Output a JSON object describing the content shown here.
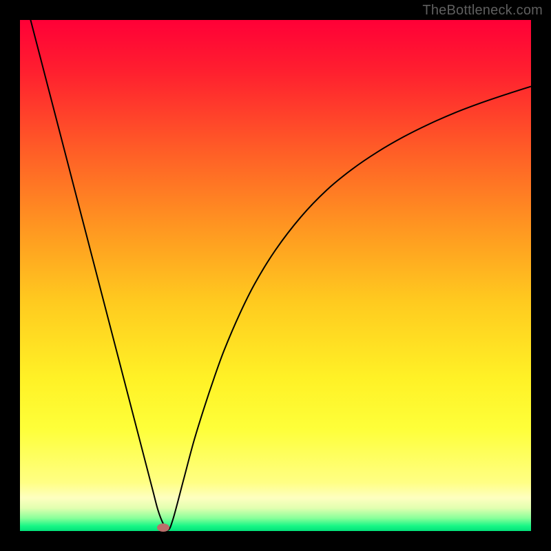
{
  "watermark": "TheBottleneck.com",
  "colors": {
    "marker": "#bb6e6b",
    "curve": "#000000",
    "frame_bg": "#000000"
  },
  "chart_data": {
    "type": "line",
    "title": "",
    "xlabel": "",
    "ylabel": "",
    "xlim": [
      0,
      100
    ],
    "ylim": [
      0,
      100
    ],
    "gradient_stops": [
      {
        "offset": 0.0,
        "color": "#ff0037"
      },
      {
        "offset": 0.1,
        "color": "#ff1f2f"
      },
      {
        "offset": 0.25,
        "color": "#ff5b27"
      },
      {
        "offset": 0.4,
        "color": "#ff9421"
      },
      {
        "offset": 0.55,
        "color": "#ffca1f"
      },
      {
        "offset": 0.7,
        "color": "#fff126"
      },
      {
        "offset": 0.8,
        "color": "#feff39"
      },
      {
        "offset": 0.905,
        "color": "#ffff84"
      },
      {
        "offset": 0.935,
        "color": "#feffc0"
      },
      {
        "offset": 0.955,
        "color": "#e2ffb0"
      },
      {
        "offset": 0.975,
        "color": "#88ff9a"
      },
      {
        "offset": 0.99,
        "color": "#18f786"
      },
      {
        "offset": 1.0,
        "color": "#03e07a"
      }
    ],
    "series": [
      {
        "name": "bottleneck-curve",
        "x": [
          0,
          2,
          4,
          6,
          8,
          10,
          12,
          14,
          16,
          18,
          20,
          22,
          24,
          26,
          27,
          28,
          29,
          30,
          32,
          34,
          36,
          38,
          40,
          43,
          46,
          50,
          55,
          60,
          65,
          70,
          75,
          80,
          85,
          90,
          95,
          100
        ],
        "y": [
          108,
          100.3,
          92.6,
          84.9,
          77.2,
          69.5,
          61.8,
          54.1,
          46.4,
          38.7,
          31.0,
          23.3,
          15.6,
          7.9,
          4.1,
          1.5,
          0.2,
          2.5,
          10.0,
          17.5,
          24.0,
          30.0,
          35.5,
          42.5,
          48.5,
          55.0,
          61.5,
          66.7,
          70.8,
          74.2,
          77.1,
          79.6,
          81.8,
          83.7,
          85.4,
          87.0
        ]
      }
    ],
    "marker": {
      "x": 28.0,
      "y": 0.7
    }
  }
}
